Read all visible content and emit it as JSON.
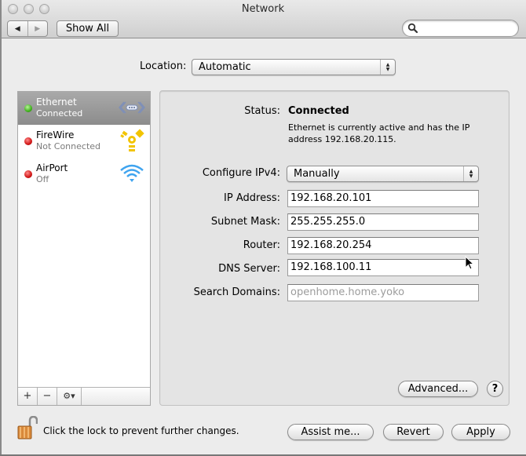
{
  "window": {
    "title": "Network",
    "traffic_lights": [
      "close",
      "minimize",
      "zoom"
    ]
  },
  "toolbar": {
    "back_icon": "◀",
    "forward_icon": "▶",
    "show_all_label": "Show All",
    "search_value": "",
    "search_placeholder": ""
  },
  "location": {
    "label": "Location:",
    "value": "Automatic"
  },
  "services": [
    {
      "name": "Ethernet",
      "status": "Connected",
      "indicator": "green",
      "icon": "ethernet-icon",
      "selected": true
    },
    {
      "name": "FireWire",
      "status": "Not Connected",
      "indicator": "red",
      "icon": "firewire-icon",
      "selected": false
    },
    {
      "name": "AirPort",
      "status": "Off",
      "indicator": "red",
      "icon": "wifi-icon",
      "selected": false
    }
  ],
  "list_controls": {
    "add": "+",
    "remove": "−",
    "action": "⚙▾"
  },
  "detail": {
    "status_label": "Status:",
    "status_value": "Connected",
    "status_description": "Ethernet is currently active and has the IP address 192.168.20.115.",
    "configure_label": "Configure IPv4:",
    "configure_value": "Manually",
    "ip_label": "IP Address:",
    "ip_value": "192.168.20.101",
    "subnet_label": "Subnet Mask:",
    "subnet_value": "255.255.255.0",
    "router_label": "Router:",
    "router_value": "192.168.20.254",
    "dns_label": "DNS Server:",
    "dns_value": "192.168.100.11",
    "search_domains_label": "Search Domains:",
    "search_domains_placeholder": "openhome.home.yoko",
    "advanced_label": "Advanced...",
    "help_label": "?"
  },
  "footer": {
    "lock_text": "Click the lock to prevent further changes.",
    "assist_label": "Assist me...",
    "revert_label": "Revert",
    "apply_label": "Apply"
  },
  "colors": {
    "indicator_green": "#4fc12a",
    "indicator_red": "#d01515",
    "selection": "#9a9a9a"
  }
}
